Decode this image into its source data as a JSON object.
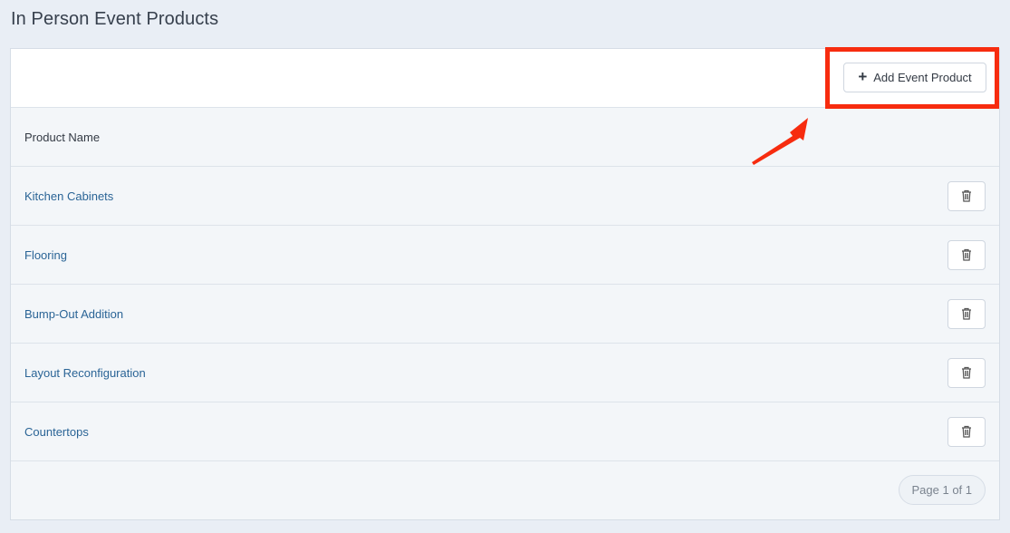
{
  "page": {
    "title": "In Person Event Products"
  },
  "toolbar": {
    "add_label": "Add Event Product",
    "add_icon": "plus-icon"
  },
  "table": {
    "header": "Product Name",
    "rows": [
      {
        "name": "Kitchen Cabinets"
      },
      {
        "name": "Flooring"
      },
      {
        "name": "Bump-Out Addition"
      },
      {
        "name": "Layout Reconfiguration"
      },
      {
        "name": "Countertops"
      }
    ],
    "delete_icon": "trash-icon"
  },
  "pagination": {
    "label": "Page 1 of 1"
  },
  "annotation": {
    "highlight_color": "#f72c0f",
    "link_color": "#2a6496"
  }
}
